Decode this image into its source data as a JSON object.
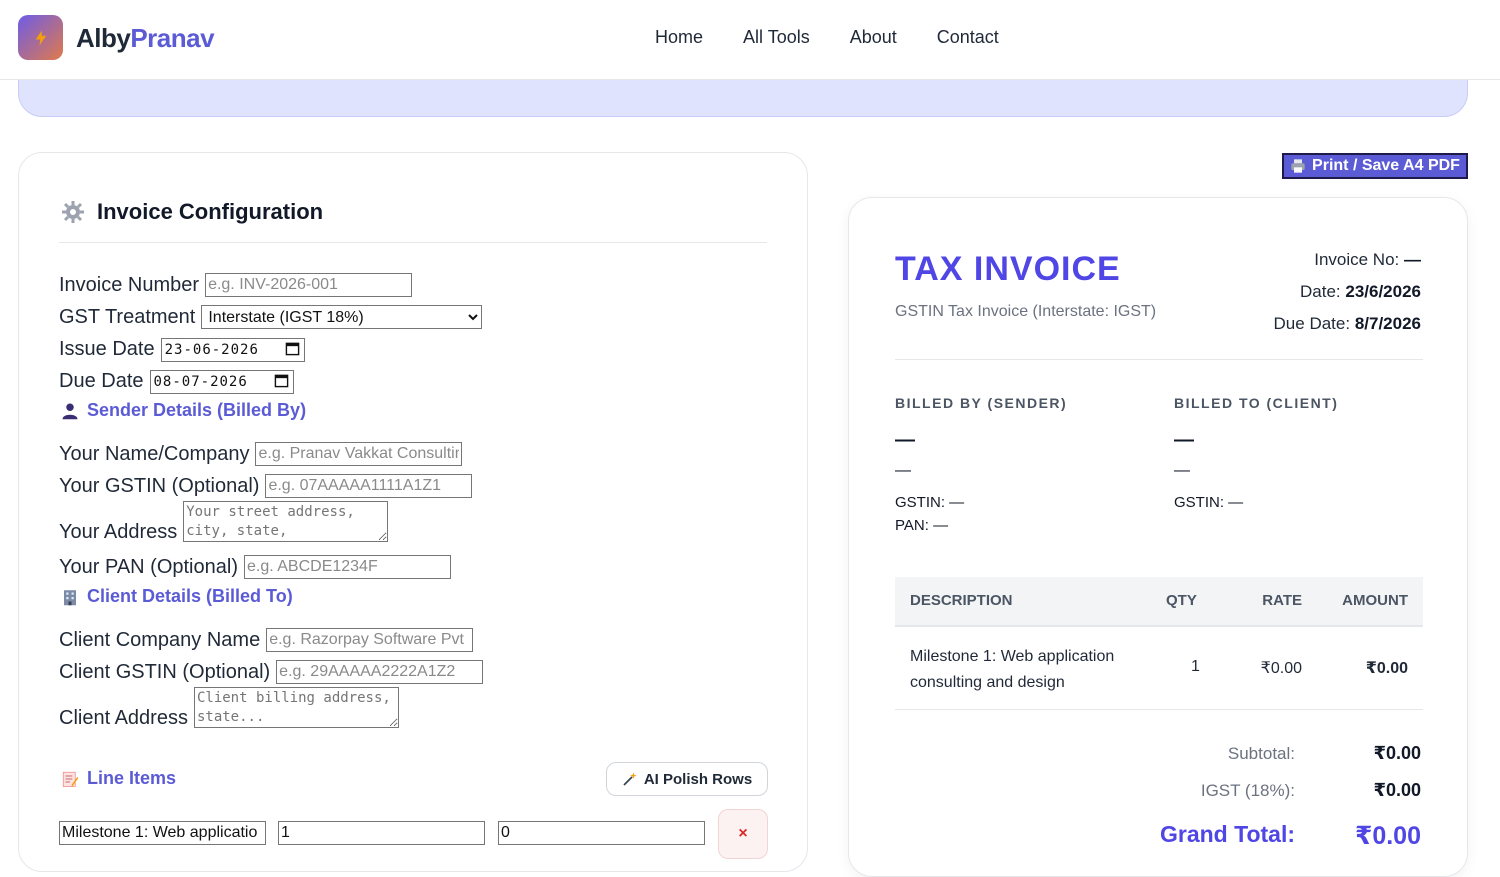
{
  "header": {
    "brand_part1": "Alby",
    "brand_part2": "Pranav",
    "nav": [
      "Home",
      "All Tools",
      "About",
      "Contact"
    ]
  },
  "config": {
    "title": "Invoice Configuration",
    "invoice_number": {
      "label": "Invoice Number",
      "placeholder": "e.g. INV-2026-001",
      "value": ""
    },
    "gst_treatment": {
      "label": "GST Treatment",
      "value": "Interstate (IGST 18%)"
    },
    "issue_date": {
      "label": "Issue Date",
      "value": "23-06-2026"
    },
    "due_date": {
      "label": "Due Date",
      "value": "08-07-2026"
    },
    "sender_section": "Sender Details (Billed By)",
    "sender_name": {
      "label": "Your Name/Company",
      "placeholder": "e.g. Pranav Vakkat Consulting"
    },
    "sender_gstin": {
      "label": "Your GSTIN (Optional)",
      "placeholder": "e.g. 07AAAAA1111A1Z1"
    },
    "sender_address": {
      "label": "Your Address",
      "placeholder": "Your street address, city, state,"
    },
    "sender_pan": {
      "label": "Your PAN (Optional)",
      "placeholder": "e.g. ABCDE1234F"
    },
    "client_section": "Client Details (Billed To)",
    "client_name": {
      "label": "Client Company Name",
      "placeholder": "e.g. Razorpay Software Pvt"
    },
    "client_gstin": {
      "label": "Client GSTIN (Optional)",
      "placeholder": "e.g. 29AAAAA2222A1Z2"
    },
    "client_address": {
      "label": "Client Address",
      "placeholder": "Client billing address, state..."
    },
    "line_items_section": "Line Items",
    "ai_polish_label": "AI Polish Rows",
    "line_item": {
      "description": "Milestone 1: Web applicatio",
      "qty": "1",
      "rate": "0"
    },
    "delete_label": "×"
  },
  "print_button": "Print / Save A4 PDF",
  "invoice": {
    "title": "TAX INVOICE",
    "subtitle": "GSTIN Tax Invoice (Interstate: IGST)",
    "invoice_no_label": "Invoice No:",
    "invoice_no": "—",
    "date_label": "Date:",
    "date": "23/6/2026",
    "due_label": "Due Date:",
    "due": "8/7/2026",
    "billed_by": {
      "heading": "BILLED BY (SENDER)",
      "name": "—",
      "address": "—",
      "gstin": "GSTIN: —",
      "pan": "PAN: —"
    },
    "billed_to": {
      "heading": "BILLED TO (CLIENT)",
      "name": "—",
      "address": "—",
      "gstin": "GSTIN: —"
    },
    "table": {
      "headers": {
        "description": "DESCRIPTION",
        "qty": "QTY",
        "rate": "RATE",
        "amount": "AMOUNT"
      },
      "rows": [
        {
          "description": "Milestone 1: Web application consulting and design",
          "qty": "1",
          "rate": "₹0.00",
          "amount": "₹0.00"
        }
      ]
    },
    "subtotal_label": "Subtotal:",
    "subtotal": "₹0.00",
    "tax_label": "IGST (18%):",
    "tax": "₹0.00",
    "grand_label": "Grand Total:",
    "grand": "₹0.00"
  },
  "colors": {
    "accent": "#4f46e5",
    "brand": "#5b5bd6",
    "hero": "#dfe3fd"
  }
}
